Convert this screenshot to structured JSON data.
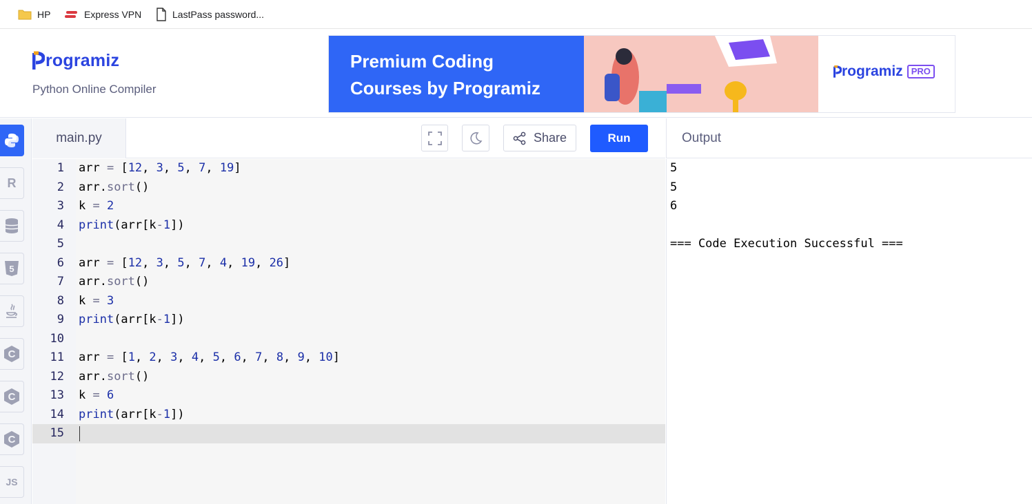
{
  "bookmarks": [
    {
      "label": "HP",
      "icon": "folder-icon"
    },
    {
      "label": "Express VPN",
      "icon": "expressvpn-icon"
    },
    {
      "label": "LastPass password...",
      "icon": "page-icon"
    }
  ],
  "header": {
    "logo": "rogramiz",
    "subtitle": "Python Online Compiler"
  },
  "banner": {
    "line1": "Premium Coding",
    "line2": "Courses by Programiz",
    "pro_logo": "rogramiz",
    "pro_badge": "PRO"
  },
  "languages": [
    {
      "name": "python",
      "label": ""
    },
    {
      "name": "r",
      "label": "R"
    },
    {
      "name": "sql",
      "label": ""
    },
    {
      "name": "html",
      "label": "5"
    },
    {
      "name": "java",
      "label": ""
    },
    {
      "name": "c",
      "label": "C"
    },
    {
      "name": "cpp",
      "label": "C"
    },
    {
      "name": "csharp",
      "label": "C"
    },
    {
      "name": "javascript",
      "label": "JS"
    }
  ],
  "editor": {
    "tab": "main.py",
    "share_label": "Share",
    "run_label": "Run",
    "lines": [
      "arr = [12, 3, 5, 7, 19]",
      "arr.sort()",
      "k = 2",
      "print(arr[k-1])",
      "",
      "arr = [12, 3, 5, 7, 4, 19, 26]",
      "arr.sort()",
      "k = 3",
      "print(arr[k-1])",
      "",
      "arr = [1, 2, 3, 4, 5, 6, 7, 8, 9, 10]",
      "arr.sort()",
      "k = 6",
      "print(arr[k-1])",
      ""
    ],
    "line_numbers": [
      "1",
      "2",
      "3",
      "4",
      "5",
      "6",
      "7",
      "8",
      "9",
      "10",
      "11",
      "12",
      "13",
      "14",
      "15"
    ]
  },
  "output": {
    "title": "Output",
    "lines": [
      "5",
      "5",
      "6",
      "",
      "=== Code Execution Successful ==="
    ]
  },
  "colors": {
    "accent": "#1f5bff",
    "brand": "#2b44e0"
  }
}
